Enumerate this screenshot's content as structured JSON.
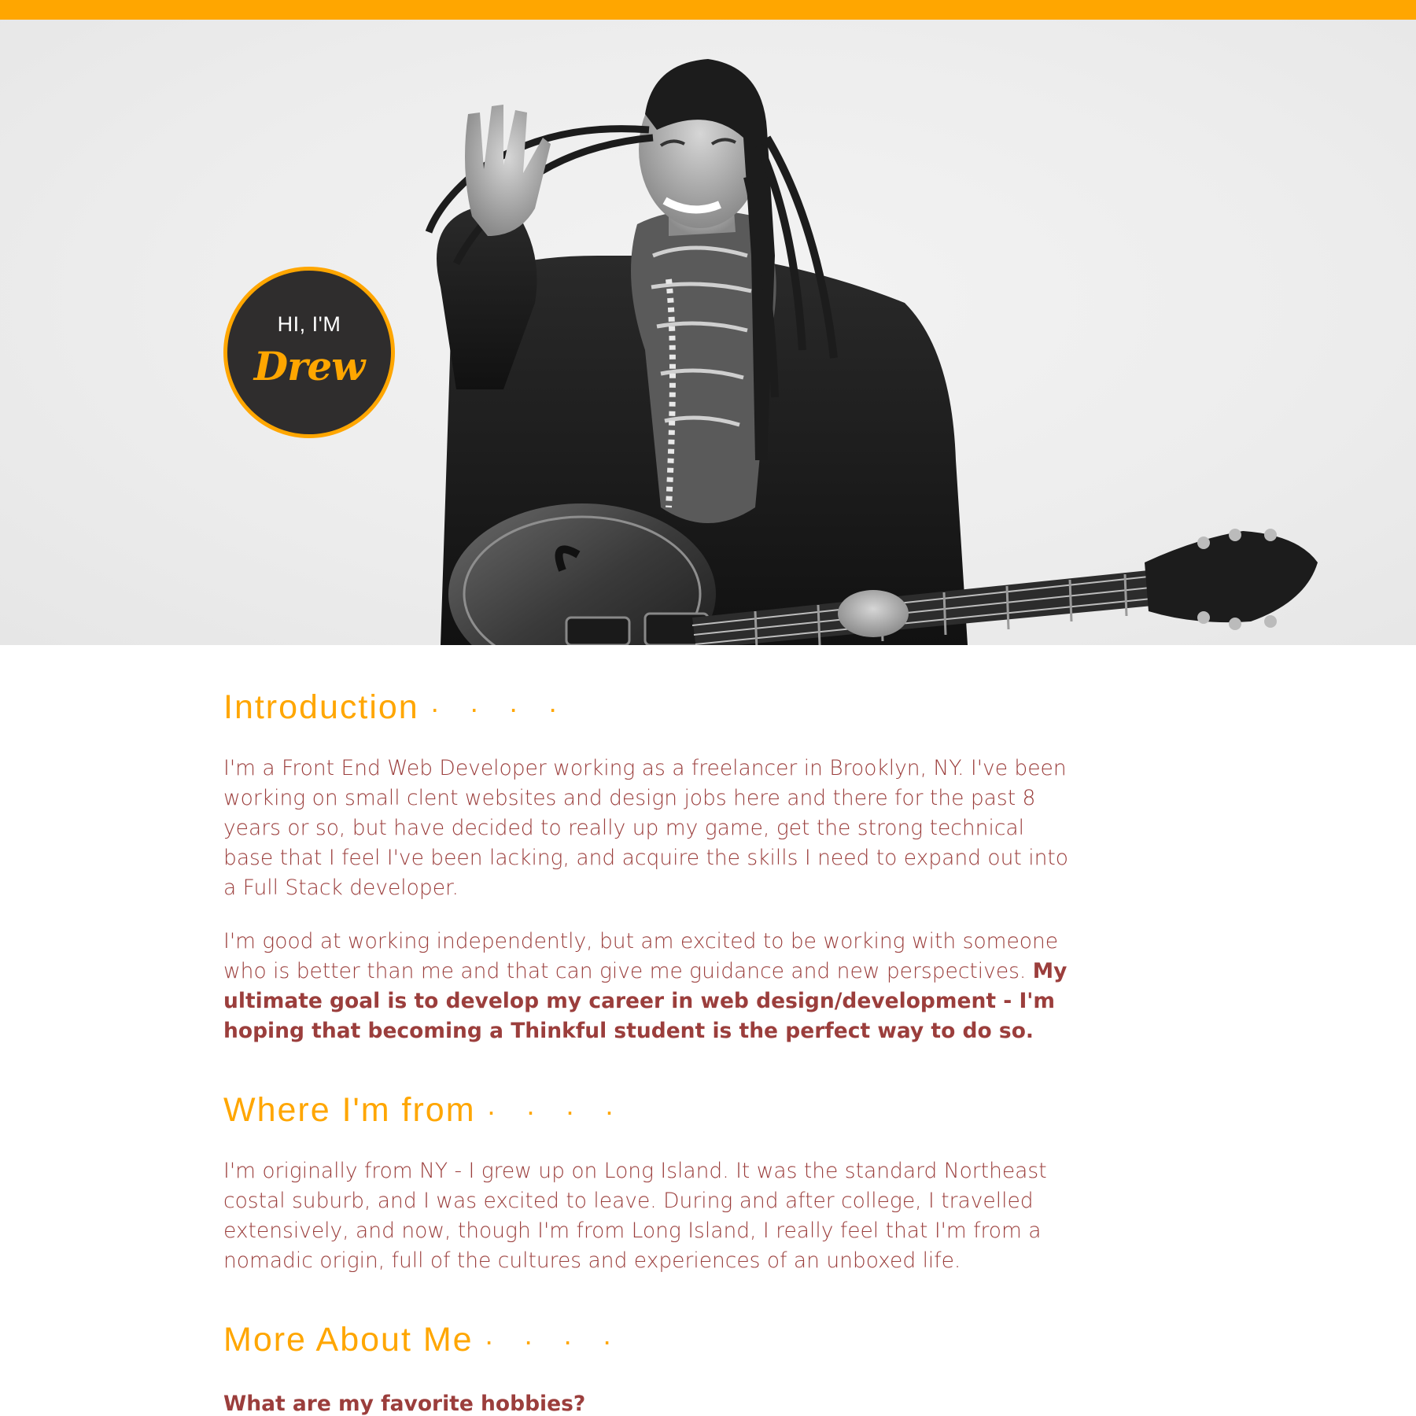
{
  "colors": {
    "accent": "#ffa600",
    "text": "#9b3e3c",
    "badge_bg": "#2f2d2d"
  },
  "hero": {
    "photo_label": "",
    "badge": {
      "greeting": "HI, I'M",
      "name": "Drew"
    }
  },
  "sections": {
    "introduction": {
      "title": "Introduction",
      "dots": "· · · ·",
      "p1": "I'm a Front End Web Developer working as a freelancer in Brooklyn, NY. I've been working on small clent websites and design jobs here and there for the past 8 years or so, but have decided to really up my game, get the strong technical base that I feel I've been lacking, and acquire the skills I need to expand out into a Full Stack developer.",
      "p2_plain": "I'm good at working independently, but am excited to be working with someone who is better than me and that can give me guidance and new perspectives. ",
      "p2_bold": "My ultimate goal is to develop my career in web design/development - I'm hoping that becoming a Thinkful student is the perfect way to do so."
    },
    "where_from": {
      "title": "Where I'm from",
      "dots": "· · · ·",
      "p1": "I'm originally from NY - I grew up on Long Island. It was the standard Northeast costal suburb, and I was excited to leave. During and after college, I travelled extensively, and now, though I'm from Long Island, I really feel that I'm from a nomadic origin, full of the cultures and experiences of an unboxed life."
    },
    "more_about": {
      "title": "More About Me",
      "dots": "· · · ·",
      "question": "What are my favorite hobbies?"
    }
  }
}
